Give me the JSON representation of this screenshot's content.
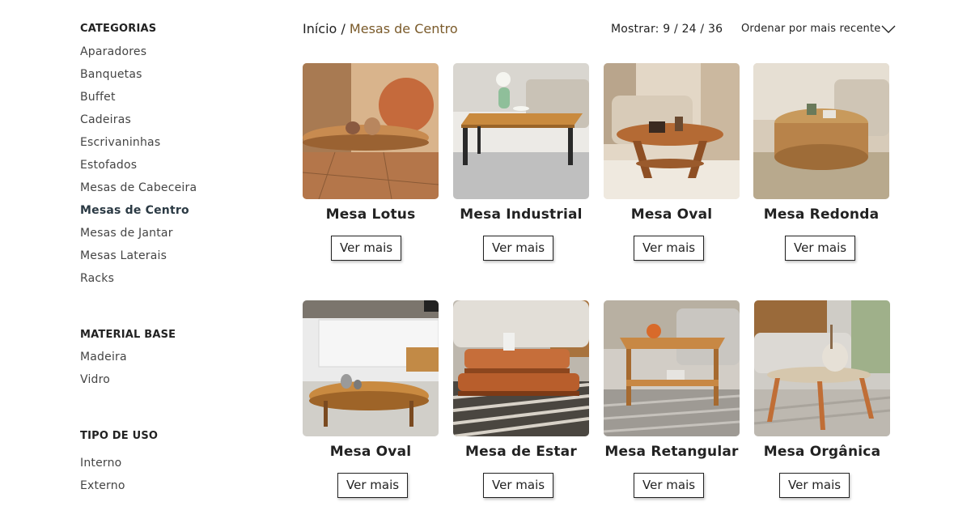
{
  "breadcrumb": {
    "home": "Início",
    "separator": "/",
    "current": "Mesas de Centro"
  },
  "toolbar": {
    "show_label": "Mostrar: 9 / 24 / 36",
    "sort_label": "Ordenar por mais recente"
  },
  "sidebar": {
    "categories": {
      "title": "CATEGORIAS",
      "items": [
        "Aparadores",
        "Banquetas",
        "Buffet",
        "Cadeiras",
        "Escrivaninhas",
        "Estofados",
        "Mesas de Cabeceira",
        "Mesas de Centro",
        "Mesas de Jantar",
        "Mesas Laterais",
        "Racks"
      ],
      "active": "Mesas de Centro"
    },
    "material": {
      "title": "MATERIAL BASE",
      "items": [
        "Madeira",
        "Vidro"
      ]
    },
    "usage": {
      "title": "TIPO DE USO",
      "items": [
        "Interno",
        "Externo"
      ]
    }
  },
  "products": [
    {
      "name": "Mesa Lotus",
      "button": "Ver mais"
    },
    {
      "name": "Mesa Industrial",
      "button": "Ver mais"
    },
    {
      "name": "Mesa Oval",
      "button": "Ver mais"
    },
    {
      "name": "Mesa Redonda",
      "button": "Ver mais"
    },
    {
      "name": "Mesa Oval",
      "button": "Ver mais"
    },
    {
      "name": "Mesa de Estar",
      "button": "Ver mais"
    },
    {
      "name": "Mesa Retangular",
      "button": "Ver mais"
    },
    {
      "name": "Mesa Orgânica",
      "button": "Ver mais"
    }
  ],
  "colors": {
    "accent": "#7a5a2a",
    "text": "#222222"
  }
}
